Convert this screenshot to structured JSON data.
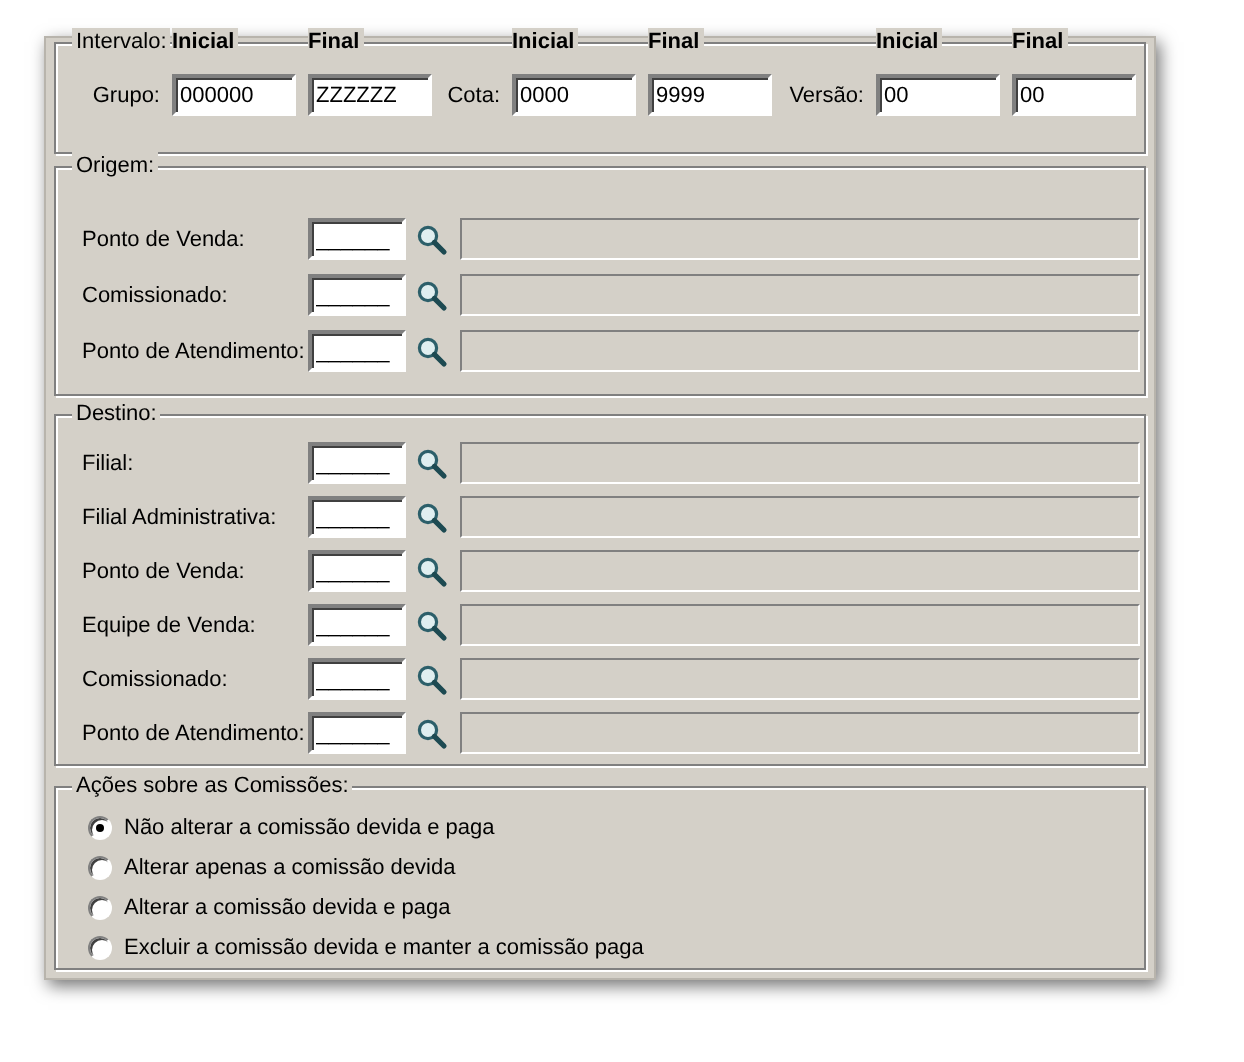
{
  "intervalo": {
    "title": "Intervalo:",
    "fields": [
      {
        "label": "Grupo:",
        "inicial_header": "Inicial",
        "final_header": "Final",
        "inicial": "000000",
        "final": "ZZZZZZ"
      },
      {
        "label": "Cota:",
        "inicial_header": "Inicial",
        "final_header": "Final",
        "inicial": "0000",
        "final": "9999"
      },
      {
        "label": "Versão:",
        "inicial_header": "Inicial",
        "final_header": "Final",
        "inicial": "00",
        "final": "00"
      }
    ]
  },
  "origem": {
    "title": "Origem:",
    "rows": [
      {
        "label": "Ponto de Venda:",
        "code": "______"
      },
      {
        "label": "Comissionado:",
        "code": "______"
      },
      {
        "label": "Ponto de Atendimento:",
        "code": "______"
      }
    ]
  },
  "destino": {
    "title": "Destino:",
    "rows": [
      {
        "label": "Filial:",
        "code": "______"
      },
      {
        "label": "Filial Administrativa:",
        "code": "______"
      },
      {
        "label": "Ponto de Venda:",
        "code": "______"
      },
      {
        "label": "Equipe de Venda:",
        "code": "______"
      },
      {
        "label": "Comissionado:",
        "code": "______"
      },
      {
        "label": "Ponto de Atendimento:",
        "code": "______"
      }
    ]
  },
  "acoes": {
    "title": "Ações sobre as Comissões:",
    "options": [
      {
        "label": "Não alterar a comissão devida e paga",
        "selected": true
      },
      {
        "label": "Alterar apenas a comissão devida",
        "selected": false
      },
      {
        "label": "Alterar a comissão devida e paga",
        "selected": false
      },
      {
        "label": "Excluir a comissão devida e manter a comissão paga",
        "selected": false
      }
    ]
  }
}
